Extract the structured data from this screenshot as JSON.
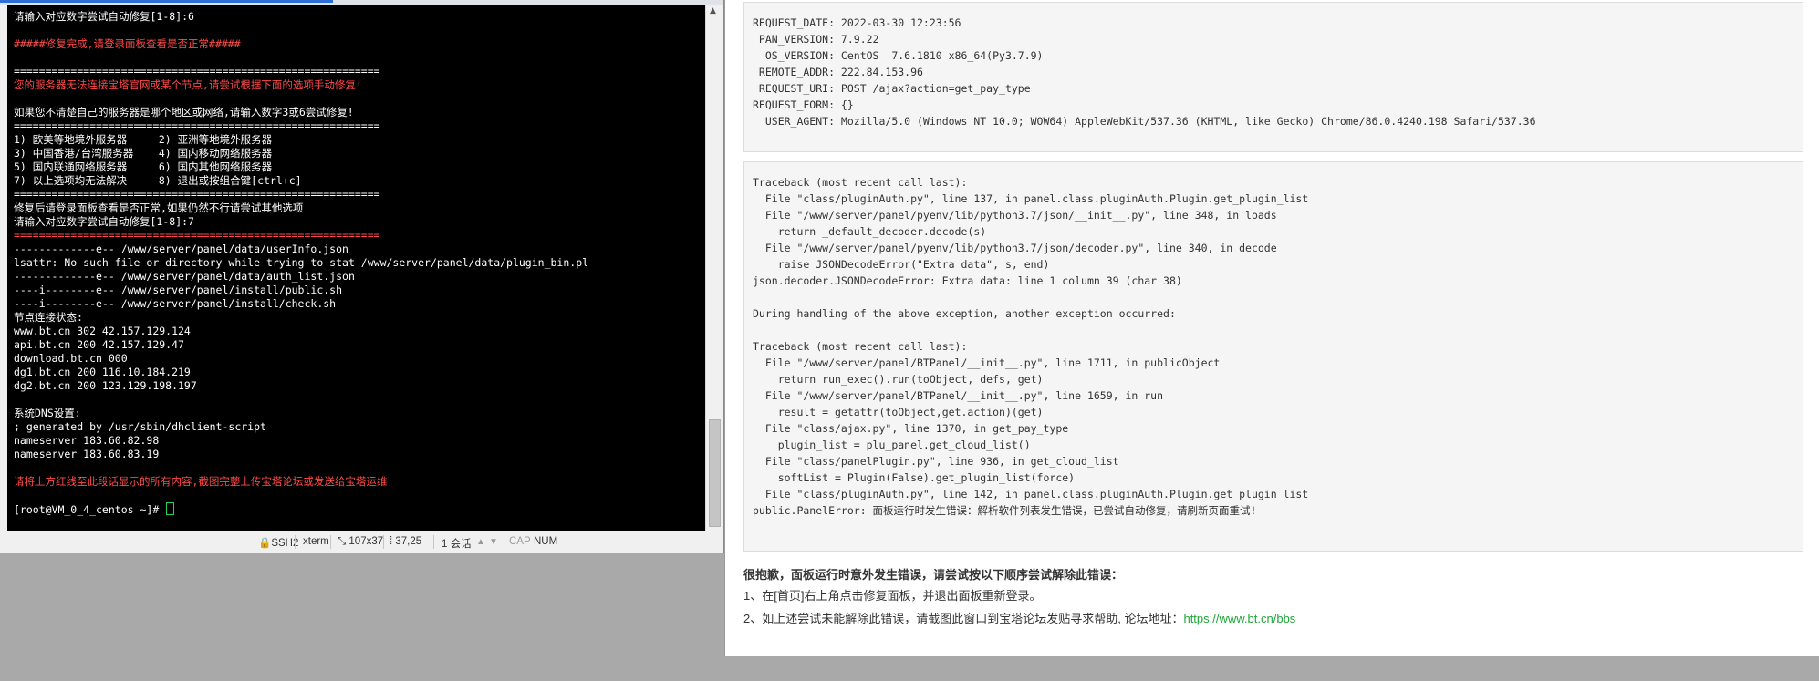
{
  "terminal": {
    "lines": [
      {
        "text": "请输入对应数字尝试自动修复[1-8]:6",
        "style": "normal"
      },
      {
        "text": "",
        "style": "normal"
      },
      {
        "text": "#####修复完成,请登录面板查看是否正常#####",
        "style": "red"
      },
      {
        "text": "",
        "style": "normal"
      },
      {
        "text": "==========================================================",
        "style": "normal"
      },
      {
        "text": "您的服务器无法连接宝塔官网或某个节点,请尝试根据下面的选项手动修复!",
        "style": "red"
      },
      {
        "text": "",
        "style": "normal"
      },
      {
        "text": "如果您不清楚自己的服务器是哪个地区或网络,请输入数字3或6尝试修复!",
        "style": "normal"
      },
      {
        "text": "==========================================================",
        "style": "normal"
      },
      {
        "text": "1) 欧美等地境外服务器     2) 亚洲等地境外服务器",
        "style": "normal"
      },
      {
        "text": "3) 中国香港/台湾服务器    4) 国内移动网络服务器",
        "style": "normal"
      },
      {
        "text": "5) 国内联通网络服务器     6) 国内其他网络服务器",
        "style": "normal"
      },
      {
        "text": "7) 以上选项均无法解决     8) 退出或按组合键[ctrl+c]",
        "style": "normal"
      },
      {
        "text": "==========================================================",
        "style": "normal"
      },
      {
        "text": "修复后请登录面板查看是否正常,如果仍然不行请尝试其他选项",
        "style": "normal"
      },
      {
        "text": "请输入对应数字尝试自动修复[1-8]:7",
        "style": "normal"
      },
      {
        "text": "==========================================================",
        "style": "red"
      },
      {
        "text": "-------------e-- /www/server/panel/data/userInfo.json",
        "style": "normal"
      },
      {
        "text": "lsattr: No such file or directory while trying to stat /www/server/panel/data/plugin_bin.pl",
        "style": "normal"
      },
      {
        "text": "-------------e-- /www/server/panel/data/auth_list.json",
        "style": "normal"
      },
      {
        "text": "----i--------e-- /www/server/panel/install/public.sh",
        "style": "normal"
      },
      {
        "text": "----i--------e-- /www/server/panel/install/check.sh",
        "style": "normal"
      },
      {
        "text": "节点连接状态:",
        "style": "normal"
      },
      {
        "text": "www.bt.cn 302 42.157.129.124",
        "style": "normal"
      },
      {
        "text": "api.bt.cn 200 42.157.129.47",
        "style": "normal"
      },
      {
        "text": "download.bt.cn 000",
        "style": "normal"
      },
      {
        "text": "dg1.bt.cn 200 116.10.184.219",
        "style": "normal"
      },
      {
        "text": "dg2.bt.cn 200 123.129.198.197",
        "style": "normal"
      },
      {
        "text": "",
        "style": "normal"
      },
      {
        "text": "系统DNS设置:",
        "style": "normal"
      },
      {
        "text": "; generated by /usr/sbin/dhclient-script",
        "style": "normal"
      },
      {
        "text": "nameserver 183.60.82.98",
        "style": "normal"
      },
      {
        "text": "nameserver 183.60.83.19",
        "style": "normal"
      },
      {
        "text": "",
        "style": "normal"
      },
      {
        "text": "请将上方红线至此段话显示的所有内容,截图完整上传宝塔论坛或发送给宝塔运维",
        "style": "red"
      },
      {
        "text": "",
        "style": "normal"
      }
    ],
    "prompt": "[root@VM_0_4_centos ~]# ",
    "cursor_color": "#22d05a",
    "red_color": "#ff4a4a"
  },
  "statusbar": {
    "protocol": "SSH2",
    "terminal_type": "xterm",
    "size": "107x37",
    "cursor_pos": "37,25",
    "sessions": "1 会话",
    "cap": "CAP",
    "num": "NUM"
  },
  "error_page": {
    "request_info": [
      "REQUEST_DATE: 2022-03-30 12:23:56",
      " PAN_VERSION: 7.9.22",
      "  OS_VERSION: CentOS  7.6.1810 x86_64(Py3.7.9)",
      " REMOTE_ADDR: 222.84.153.96",
      " REQUEST_URI: POST /ajax?action=get_pay_type",
      "REQUEST_FORM: {}",
      "  USER_AGENT: Mozilla/5.0 (Windows NT 10.0; WOW64) AppleWebKit/537.36 (KHTML, like Gecko) Chrome/86.0.4240.198 Safari/537.36"
    ],
    "traceback": [
      "Traceback (most recent call last):",
      "  File \"class/pluginAuth.py\", line 137, in panel.class.pluginAuth.Plugin.get_plugin_list",
      "  File \"/www/server/panel/pyenv/lib/python3.7/json/__init__.py\", line 348, in loads",
      "    return _default_decoder.decode(s)",
      "  File \"/www/server/panel/pyenv/lib/python3.7/json/decoder.py\", line 340, in decode",
      "    raise JSONDecodeError(\"Extra data\", s, end)",
      "json.decoder.JSONDecodeError: Extra data: line 1 column 39 (char 38)",
      "",
      "During handling of the above exception, another exception occurred:",
      "",
      "Traceback (most recent call last):",
      "  File \"/www/server/panel/BTPanel/__init__.py\", line 1711, in publicObject",
      "    return run_exec().run(toObject, defs, get)",
      "  File \"/www/server/panel/BTPanel/__init__.py\", line 1659, in run",
      "    result = getattr(toObject,get.action)(get)",
      "  File \"class/ajax.py\", line 1370, in get_pay_type",
      "    plugin_list = plu_panel.get_cloud_list()",
      "  File \"class/panelPlugin.py\", line 936, in get_cloud_list",
      "    softList = Plugin(False).get_plugin_list(force)",
      "  File \"class/pluginAuth.py\", line 142, in panel.class.pluginAuth.Plugin.get_plugin_list",
      "public.PanelError: 面板运行时发生错误：解析软件列表发生错误，已尝试自动修复，请刷新页面重试!"
    ],
    "help_title": "很抱歉，面板运行时意外发生错误，请尝试按以下顺序尝试解除此错误：",
    "help_step1": "1、在[首页]右上角点击修复面板，并退出面板重新登录。",
    "help_step2": "2、如上述尝试未能解除此错误，请截图此窗口到宝塔论坛发贴寻求帮助, 论坛地址：",
    "forum_url": "https://www.bt.cn/bbs",
    "link_color": "#20a53a"
  }
}
